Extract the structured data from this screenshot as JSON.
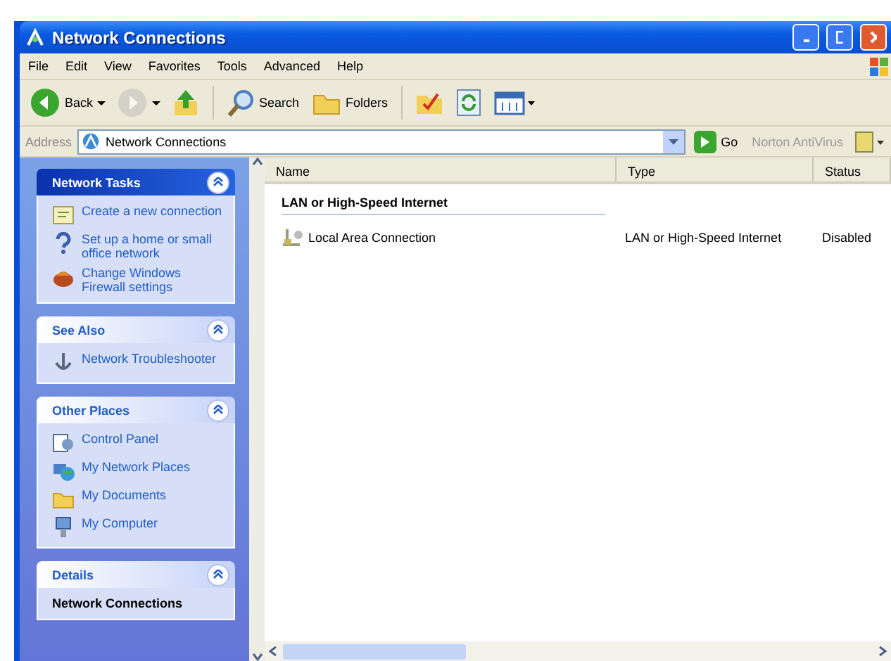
{
  "window": {
    "title": "Network Connections"
  },
  "menu": [
    {
      "label": "File"
    },
    {
      "label": "Edit"
    },
    {
      "label": "View"
    },
    {
      "label": "Favorites"
    },
    {
      "label": "Tools"
    },
    {
      "label": "Advanced"
    },
    {
      "label": "Help"
    }
  ],
  "toolbar": [
    {
      "kind": "back",
      "label": "Back",
      "disabled": false
    },
    {
      "kind": "forward",
      "disabled": true
    },
    {
      "kind": "up",
      "disabled": false
    },
    {
      "kind": "search",
      "label": "Search",
      "disabled": false
    },
    {
      "kind": "folders",
      "label": "Folders",
      "disabled": false
    },
    {
      "kind": "move",
      "disabled": false
    },
    {
      "kind": "refresh",
      "disabled": false
    },
    {
      "kind": "views",
      "disabled": false
    }
  ],
  "address": {
    "label": "Address",
    "value": "Network Connections",
    "go": "Go",
    "addon": "Norton AntiVirus"
  },
  "sidebar": [
    {
      "title": "Network Tasks",
      "kind": "special",
      "expanded": true,
      "items": [
        {
          "kind": "wizard",
          "label": "Create a new connection"
        },
        {
          "kind": "home-network",
          "label": "Set up a home or small office network"
        },
        {
          "kind": "firewall",
          "label": "Change Windows Firewall settings"
        }
      ]
    },
    {
      "title": "See Also",
      "kind": "normal",
      "expanded": true,
      "items": [
        {
          "kind": "help",
          "label": "Network Troubleshooter"
        }
      ]
    },
    {
      "title": "Other Places",
      "kind": "normal",
      "expanded": true,
      "items": [
        {
          "kind": "control-panel",
          "label": "Control Panel"
        },
        {
          "kind": "network-places",
          "label": "My Network Places"
        },
        {
          "kind": "documents",
          "label": "My Documents"
        },
        {
          "kind": "computer",
          "label": "My Computer"
        }
      ]
    },
    {
      "title": "Details",
      "kind": "details",
      "expanded": true,
      "items": [
        {
          "kind": "heading",
          "label": "Network Connections"
        }
      ]
    }
  ],
  "columns": [
    {
      "label": "Name"
    },
    {
      "label": "Type"
    },
    {
      "label": "Status"
    }
  ],
  "groups": [
    {
      "title": "LAN or High-Speed Internet",
      "rows": [
        {
          "name": "Local Area Connection",
          "type": "LAN or High-Speed Internet",
          "status": "Disabled",
          "disabled": true,
          "selected": false
        }
      ]
    }
  ]
}
